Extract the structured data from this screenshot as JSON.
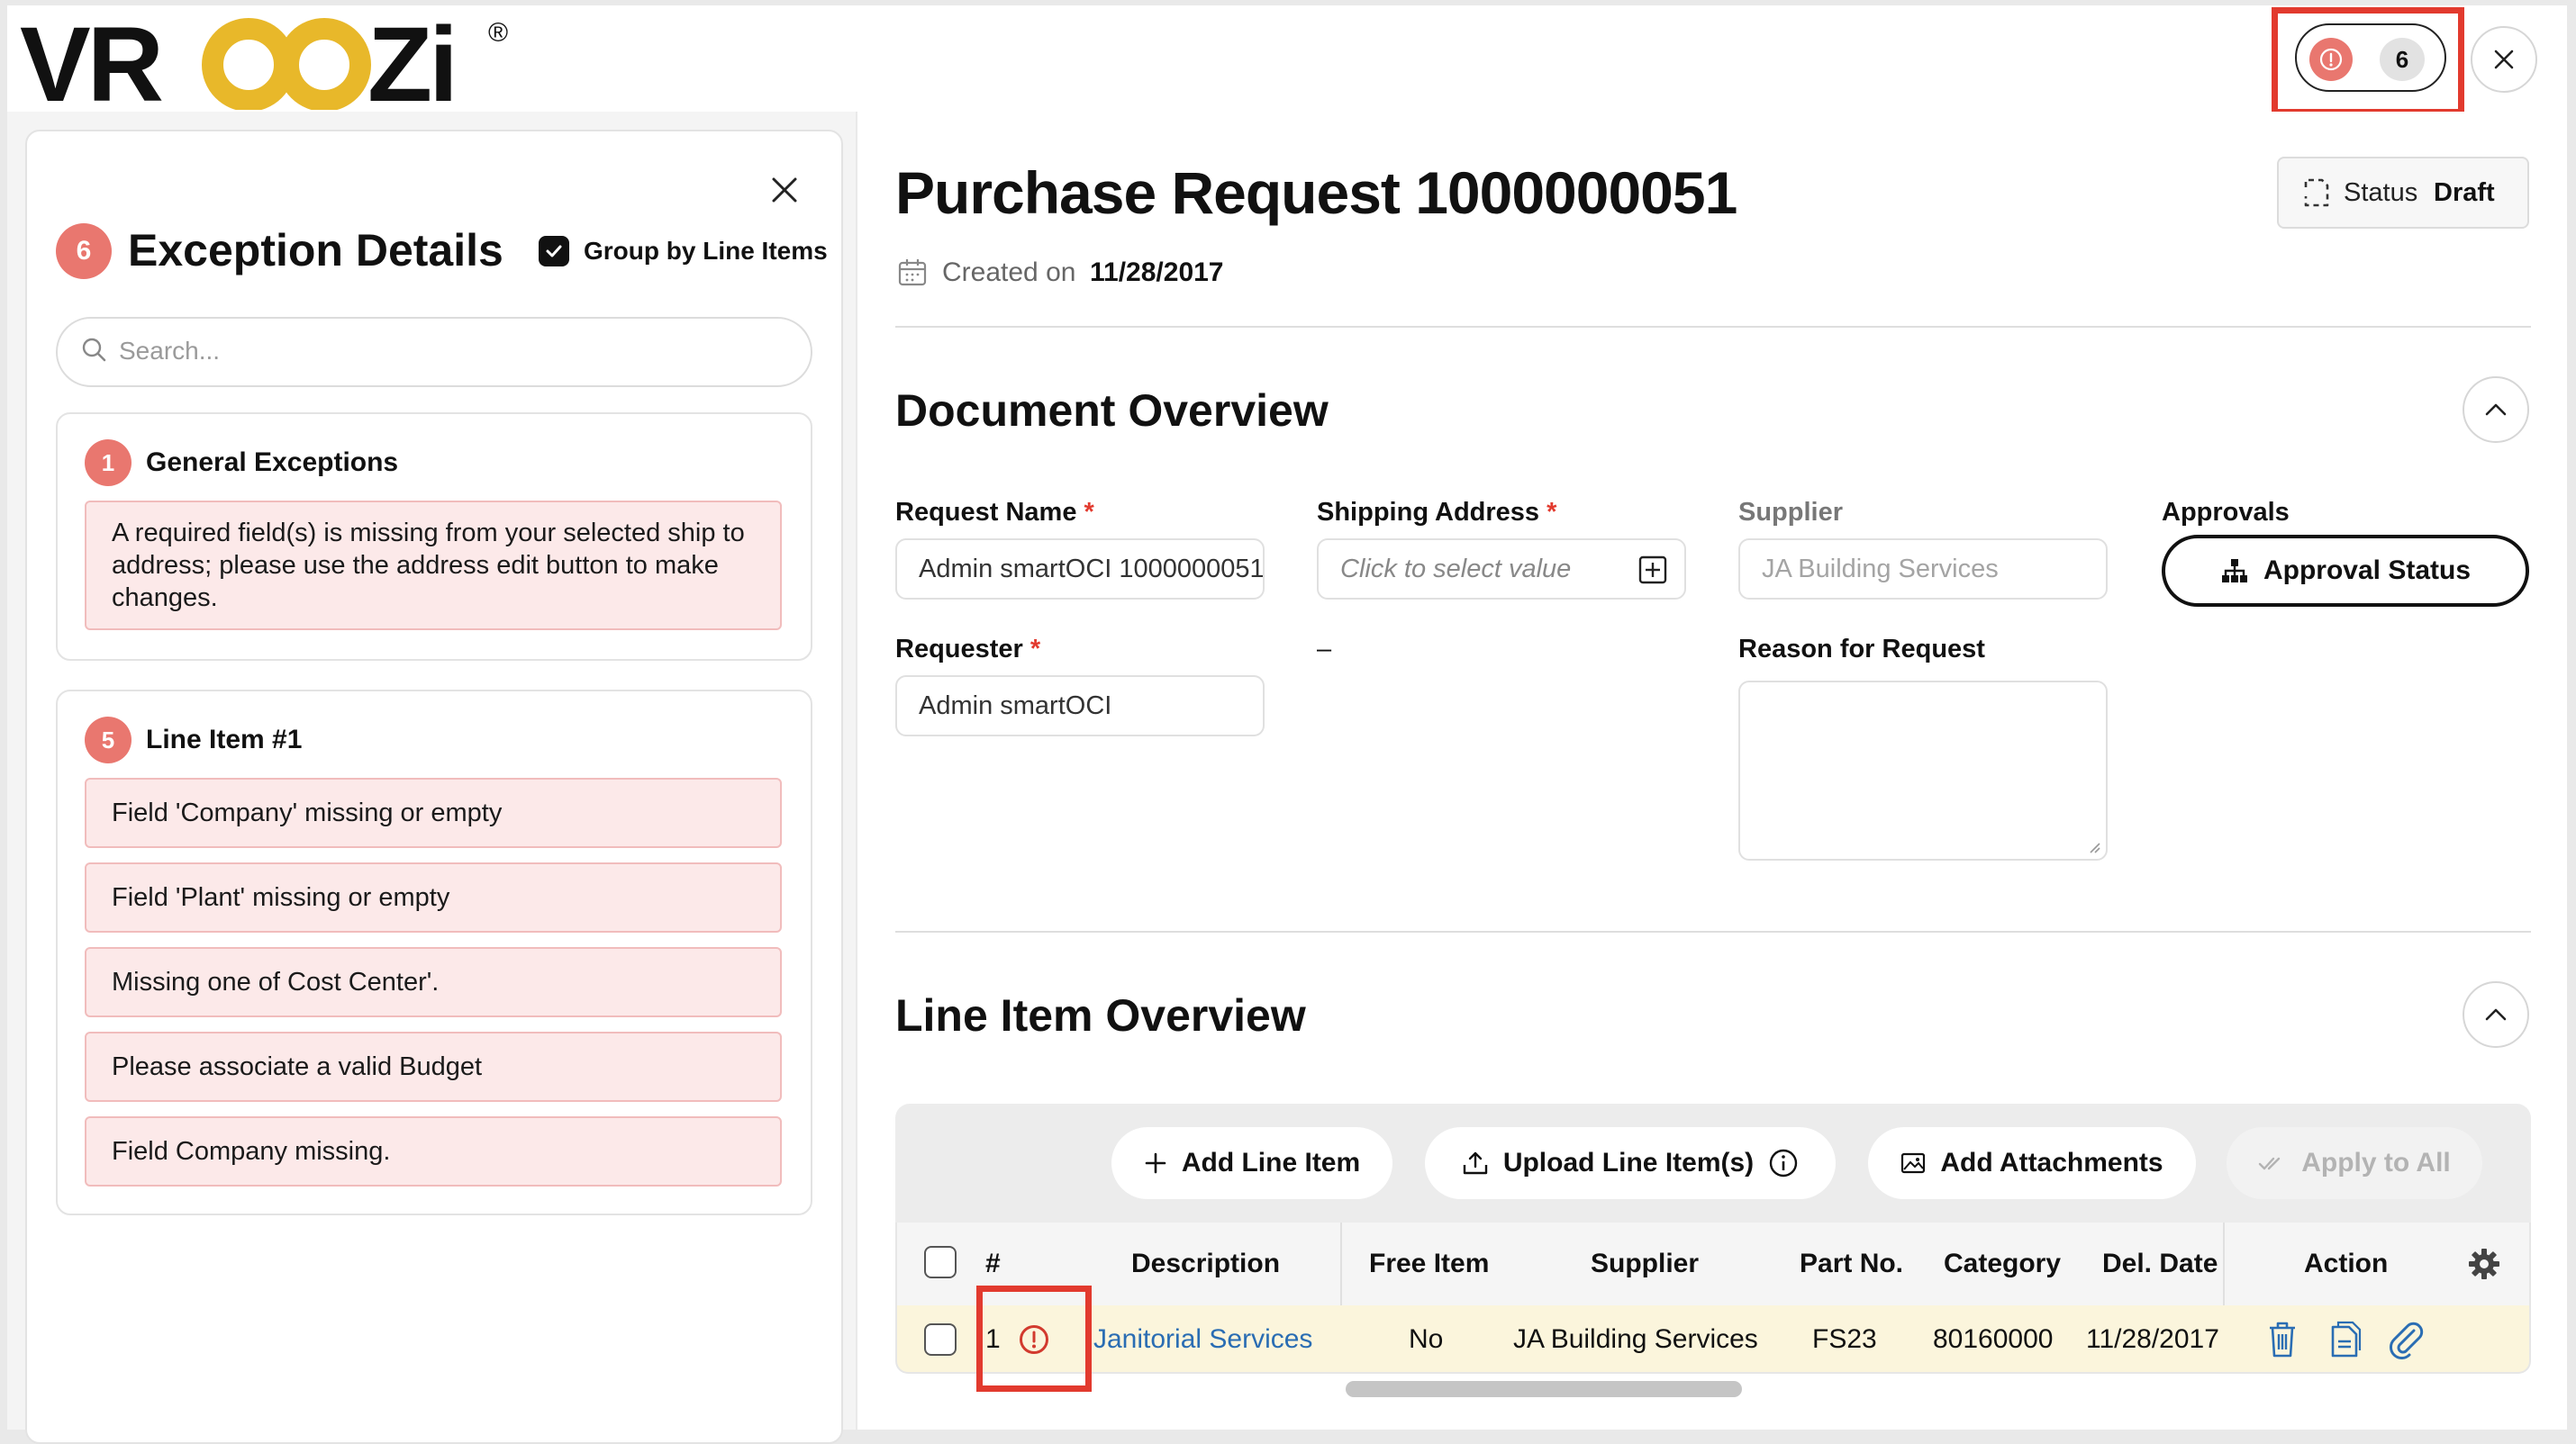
{
  "app": {
    "logo_text": "VROOZI",
    "registered_mark": "®",
    "exception_count": "6"
  },
  "exception_panel": {
    "badge": "6",
    "title": "Exception Details",
    "group_label": "Group by Line Items",
    "search_placeholder": "Search...",
    "groups": [
      {
        "badge": "1",
        "title": "General Exceptions",
        "items": [
          "A required field(s) is missing from your selected ship to address; please use the address edit button to make changes."
        ]
      },
      {
        "badge": "5",
        "title": "Line Item #1",
        "items": [
          "Field 'Company' missing or empty",
          "Field 'Plant' missing or empty",
          "Missing one of Cost Center'.",
          "Please associate a valid Budget",
          "Field Company missing."
        ]
      }
    ]
  },
  "header": {
    "title": "Purchase Request 1000000051",
    "status_label": "Status",
    "status_value": "Draft",
    "created_label": "Created on",
    "created_value": "11/28/2017"
  },
  "document_overview": {
    "title": "Document Overview",
    "request_name_label": "Request Name",
    "request_name_value": "Admin smartOCI 1000000051",
    "shipping_address_label": "Shipping Address",
    "shipping_address_placeholder": "Click to select value",
    "supplier_label": "Supplier",
    "supplier_value": "JA Building Services",
    "approvals_label": "Approvals",
    "approval_status_label": "Approval Status",
    "requester_label": "Requester",
    "requester_value": "Admin smartOCI",
    "dash": "–",
    "reason_label": "Reason for Request",
    "required_mark": "*"
  },
  "line_item_overview": {
    "title": "Line Item Overview",
    "toolbar": {
      "add_line_item": "Add Line Item",
      "upload_line_items": "Upload Line Item(s)",
      "add_attachments": "Add Attachments",
      "apply_to_all": "Apply to All"
    },
    "columns": [
      "#",
      "Description",
      "Free Item",
      "Supplier",
      "Part No.",
      "Category",
      "Del. Date",
      "Action"
    ],
    "rows": [
      {
        "num": "1",
        "description": "Janitorial Services",
        "free_item": "No",
        "supplier": "JA Building Services",
        "part_no": "FS23",
        "category": "80160000",
        "del_date": "11/28/2017"
      }
    ]
  },
  "colors": {
    "accent_red": "#e9776f",
    "highlight_red": "#e23a2e",
    "logo_gold": "#e8b82a",
    "exception_bg": "#fce9e9",
    "row_highlight": "#fbf5dc",
    "link_blue": "#2a6db3"
  },
  "icons": [
    "alert-circle-icon",
    "close-icon",
    "check-icon",
    "search-icon",
    "document-status-icon",
    "calendar-icon",
    "chevron-up-icon",
    "add-box-icon",
    "hierarchy-icon",
    "plus-icon",
    "upload-icon",
    "info-icon",
    "image-icon",
    "double-check-icon",
    "gear-icon",
    "trash-icon",
    "copy-icon",
    "paperclip-icon"
  ]
}
